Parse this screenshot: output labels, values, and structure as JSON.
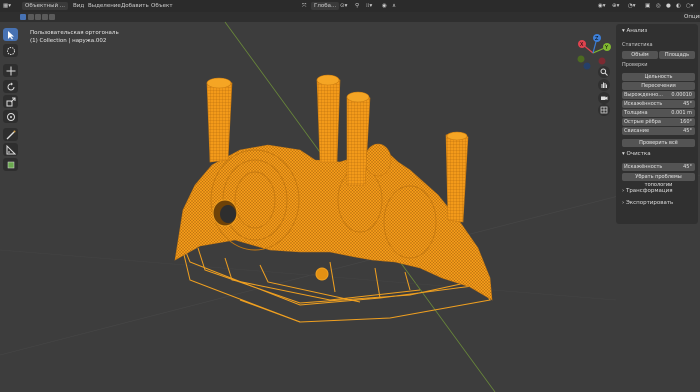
{
  "topbar": {
    "mode": "Объектный ...",
    "menu": [
      "Вид",
      "Выделение",
      "Добавить",
      "Объект"
    ],
    "transform_orientation": "Глоба...",
    "options_tab": "Опции"
  },
  "viewport": {
    "view_name": "Пользовательская ортогональ",
    "collection_info": "(1) Collection | наружа.002"
  },
  "npanel": {
    "header": "Анализ",
    "stats": {
      "title": "Статистика",
      "buttons": [
        "Объём",
        "Площадь"
      ]
    },
    "checks": {
      "title": "Проверки",
      "buttons": [
        "Цельность",
        "Пересечения"
      ],
      "rows": [
        {
          "label": "Вырожденно...",
          "value": "0.00010"
        },
        {
          "label": "Искажённость",
          "value": "45°"
        },
        {
          "label": "Толщина",
          "value": "0.001 m"
        },
        {
          "label": "Острые рёбра",
          "value": "160°"
        },
        {
          "label": "Свисание",
          "value": "45°"
        }
      ],
      "check_all": "Проверить всё"
    },
    "cleanup": {
      "title": "Очистка",
      "row": {
        "label": "Искажённость",
        "value": "45°"
      },
      "fix_button": "Убрать проблемы топологии"
    },
    "transform": "Трансформация",
    "export": "Экспортировать"
  },
  "colors": {
    "accent": "#4772b3",
    "mesh": "#f0a020",
    "mesh_dark": "#b06a08",
    "background": "#3d3d3d"
  }
}
